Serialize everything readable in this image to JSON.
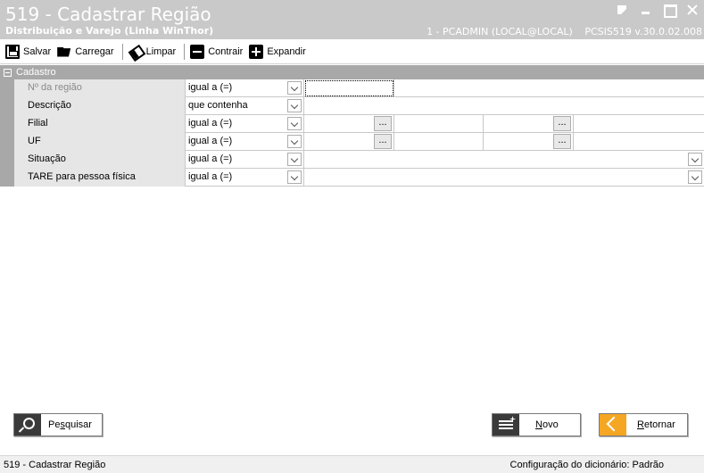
{
  "window": {
    "title": "519 - Cadastrar Região",
    "subtitle": "Distribuição e Varejo (Linha WinThor)",
    "user": "1 - PCADMIN (LOCAL@LOCAL)",
    "version": "PCSIS519  v.30.0.02.008"
  },
  "toolbar": {
    "save": "Salvar",
    "load": "Carregar",
    "clear": "Limpar",
    "collapse": "Contrair",
    "expand": "Expandir"
  },
  "section": {
    "title": "Cadastro"
  },
  "filters": [
    {
      "label": "Nº da região",
      "operator": "igual a (=)"
    },
    {
      "label": "Descrição",
      "operator": "que contenha"
    },
    {
      "label": "Filial",
      "operator": "igual a (=)"
    },
    {
      "label": "UF",
      "operator": "igual a (=)"
    },
    {
      "label": "Situação",
      "operator": "igual a (=)"
    },
    {
      "label": "TARE para pessoa física",
      "operator": "igual a (=)"
    }
  ],
  "ellipsis": "...",
  "buttons": {
    "search_pre": "Pe",
    "search_acc": "s",
    "search_post": "quisar",
    "new_acc": "N",
    "new_post": "ovo",
    "back_acc": "R",
    "back_post": "etornar"
  },
  "status": {
    "left": "519 - Cadastrar Região",
    "right": "Configuração do dicionário: Padrão"
  }
}
